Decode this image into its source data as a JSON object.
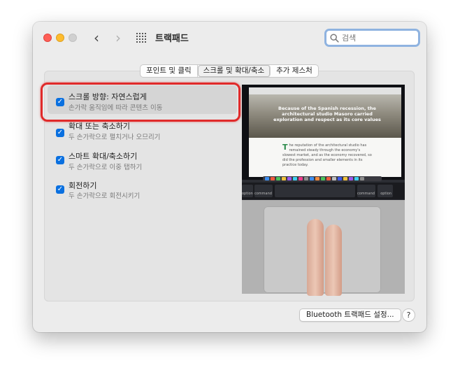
{
  "window": {
    "title": "트랙패드",
    "search": {
      "placeholder": "검색"
    }
  },
  "tabs": [
    {
      "label": "포인트 및 클릭",
      "active": false
    },
    {
      "label": "스크롤 및 확대/축소",
      "active": true
    },
    {
      "label": "추가 제스처",
      "active": false
    }
  ],
  "options": [
    {
      "title": "스크롤 방향: 자연스럽게",
      "subtitle": "손가락 움직임에 따라 콘텐츠 이동",
      "checked": true,
      "highlighted": true
    },
    {
      "title": "확대 또는 축소하기",
      "subtitle": "두 손가락으로 펼치거나 오므리기",
      "checked": true
    },
    {
      "title": "스마트 확대/축소하기",
      "subtitle": "두 손가락으로 이중 탭하기",
      "checked": true
    },
    {
      "title": "회전하기",
      "subtitle": "두 손가락으로 회전시키기",
      "checked": true
    }
  ],
  "preview": {
    "headline": "Because of the Spanish recession, the architectural studio Masoro carried exploration and respect as its core values",
    "body_initial": "T",
    "body": "he reputation of the architectural studio has remained steady through the economy's slowest market, and as the economy recovered, so did the profession and smaller elements in its practice today.",
    "keys": {
      "option_left": "option",
      "command_left": "command",
      "command_right": "command",
      "option_right": "option"
    }
  },
  "footer": {
    "bluetooth_button": "Bluetooth 트랙패드 설정...",
    "help_button": "?"
  },
  "colors": {
    "accent": "#0a70e0",
    "highlight_ring": "#e02a2a",
    "window_bg": "#ececec"
  }
}
